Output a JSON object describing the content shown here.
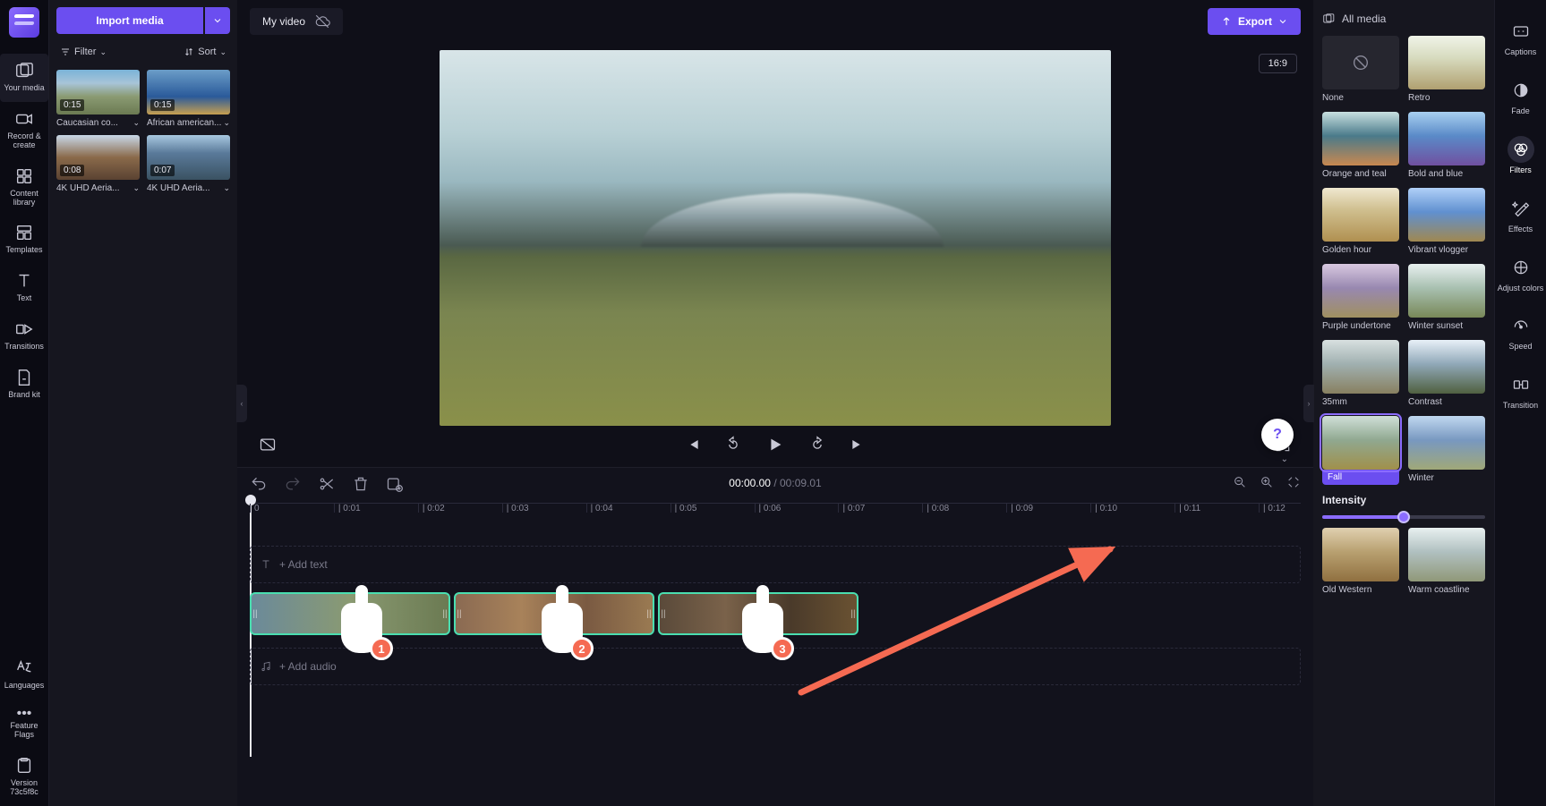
{
  "sidebar": {
    "items": [
      {
        "label": "Your media"
      },
      {
        "label": "Record & create"
      },
      {
        "label": "Content library"
      },
      {
        "label": "Templates"
      },
      {
        "label": "Text"
      },
      {
        "label": "Transitions"
      },
      {
        "label": "Brand kit"
      }
    ],
    "footer": [
      {
        "label": "Languages"
      },
      {
        "label": "Feature Flags"
      },
      {
        "label": "Version 73c5f8c"
      }
    ]
  },
  "media_panel": {
    "import_label": "Import media",
    "filter_label": "Filter",
    "sort_label": "Sort",
    "items": [
      {
        "duration": "0:15",
        "name": "Caucasian co..."
      },
      {
        "duration": "0:15",
        "name": "African american..."
      },
      {
        "duration": "0:08",
        "name": "4K UHD Aeria..."
      },
      {
        "duration": "0:07",
        "name": "4K UHD Aeria..."
      }
    ]
  },
  "top": {
    "video_name": "My video",
    "export_label": "Export",
    "aspect": "16:9"
  },
  "playback": {
    "current_time": "00:00.00",
    "total_time": "00:09.01"
  },
  "timeline": {
    "ticks": [
      "0",
      "| 0:01",
      "| 0:02",
      "| 0:03",
      "| 0:04",
      "| 0:05",
      "| 0:06",
      "| 0:07",
      "| 0:08",
      "| 0:09",
      "| 0:10",
      "| 0:11",
      "| 0:12"
    ],
    "add_text": "+  Add text",
    "add_audio": "+  Add audio"
  },
  "annotations": {
    "hand1": "1",
    "hand2": "2",
    "hand3": "3"
  },
  "filter_panel": {
    "header": "All media",
    "items": [
      {
        "label": "None"
      },
      {
        "label": "Retro"
      },
      {
        "label": "Orange and teal"
      },
      {
        "label": "Bold and blue"
      },
      {
        "label": "Golden hour"
      },
      {
        "label": "Vibrant vlogger"
      },
      {
        "label": "Purple undertone"
      },
      {
        "label": "Winter sunset"
      },
      {
        "label": "35mm"
      },
      {
        "label": "Contrast"
      },
      {
        "label": "Fall"
      },
      {
        "label": "Winter"
      },
      {
        "label": "Old Western"
      },
      {
        "label": "Warm coastline"
      }
    ],
    "intensity_label": "Intensity"
  },
  "right_sidebar": {
    "items": [
      {
        "label": "Captions"
      },
      {
        "label": "Fade"
      },
      {
        "label": "Filters"
      },
      {
        "label": "Effects"
      },
      {
        "label": "Adjust colors"
      },
      {
        "label": "Speed"
      },
      {
        "label": "Transition"
      }
    ]
  }
}
